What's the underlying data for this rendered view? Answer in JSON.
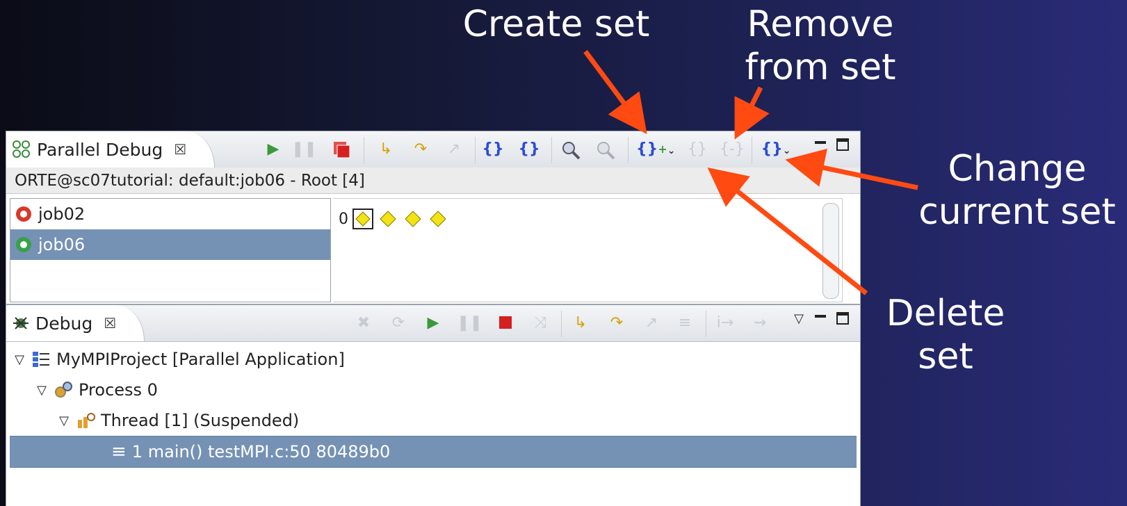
{
  "callouts": {
    "create_set": "Create set",
    "remove_from_set": "Remove\nfrom set",
    "change_current_set": "Change\ncurrent set",
    "delete_set": "Delete\nset"
  },
  "colors": {
    "arrow": "#ff4a12",
    "selection": "#7592b5",
    "callout_text": "#ffffff"
  },
  "parallel_debug": {
    "tab_label": "Parallel Debug",
    "tab_close": "☒",
    "info_bar": "ORTE@sc07tutorial: default:job06 - Root [4]",
    "toolbar_icons": [
      "resume-icon",
      "suspend-icon",
      "terminate-icon",
      "step-into-icon",
      "step-over-icon",
      "step-return-icon",
      "register-icon",
      "unregister-icon",
      "zoom-in-icon",
      "zoom-out-icon",
      "create-set-icon",
      "delete-set-icon",
      "remove-from-set-icon",
      "change-set-icon"
    ],
    "jobs": [
      {
        "label": "job02",
        "selected": false
      },
      {
        "label": "job06",
        "selected": true
      }
    ],
    "process_rank_label": "0",
    "process_count": 4
  },
  "debug": {
    "tab_label": "Debug",
    "tab_close": "☒",
    "tree": [
      {
        "level": 0,
        "label": "MyMPIProject [Parallel Application]",
        "icon": "launch-icon",
        "expanded": true,
        "selected": false
      },
      {
        "level": 1,
        "label": "Process 0",
        "icon": "process-icon",
        "expanded": true,
        "selected": false
      },
      {
        "level": 2,
        "label": "Thread [1] (Suspended)",
        "icon": "thread-icon",
        "expanded": true,
        "selected": false
      },
      {
        "level": 3,
        "label": "1 main() testMPI.c:50 80489b0",
        "icon": "stack-frame-icon",
        "expanded": null,
        "selected": true
      }
    ]
  }
}
